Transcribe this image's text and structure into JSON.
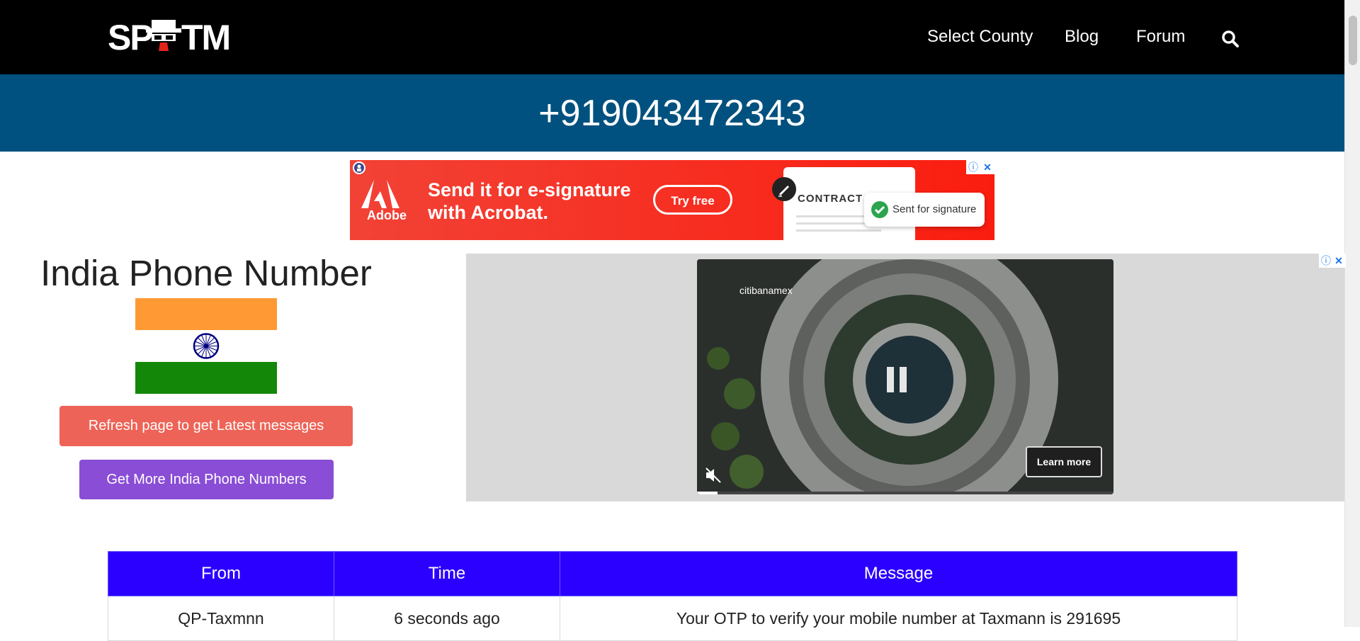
{
  "nav": {
    "logo_text": "SPYTM",
    "items": [
      {
        "label": "Select County"
      },
      {
        "label": "Blog"
      },
      {
        "label": "Forum"
      }
    ],
    "search_icon": "search-icon"
  },
  "number_band": {
    "phone_number": "+919043472343"
  },
  "top_ad": {
    "brand": "Adobe",
    "headline_line1": "Send it for e-signature",
    "headline_line2": "with Acrobat.",
    "cta": "Try free",
    "doc_label": "CONTRACT",
    "status_text": "Sent for signature",
    "colors": {
      "background": "#f24236",
      "status_check": "#2da44e"
    }
  },
  "country": {
    "title": "India Phone Number",
    "flag_colors": {
      "saffron": "#ff9933",
      "white": "#ffffff",
      "green": "#138808",
      "chakra": "#000080"
    }
  },
  "buttons": {
    "refresh": "Refresh page to get Latest messages",
    "more_numbers": "Get More India Phone Numbers"
  },
  "video_ad": {
    "brand": "citibanamex",
    "cta": "Learn more",
    "progress": 0.05
  },
  "messages_table": {
    "headers": [
      "From",
      "Time",
      "Message"
    ],
    "rows": [
      {
        "from": "QP-Taxmnn",
        "time": "6 seconds ago",
        "message": "Your OTP to verify your mobile number at Taxmann is 291695"
      }
    ],
    "header_color": "#2b00ff"
  }
}
